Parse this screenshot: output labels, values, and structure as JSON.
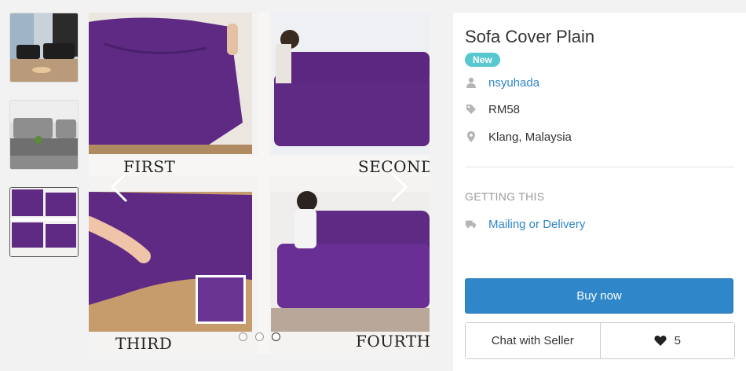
{
  "gallery": {
    "panel_labels": {
      "first": "FIRST",
      "second": "SECOND",
      "third": "THIRD",
      "fourth": "FOURTH"
    },
    "dots": 3,
    "active_dot": 3,
    "accent_purple": "#5e2a84"
  },
  "listing": {
    "title": "Sofa Cover Plain",
    "condition_badge": "New",
    "seller": "nsyuhada",
    "price": "RM58",
    "location": "Klang, Malaysia"
  },
  "getting": {
    "heading": "GETTING THIS",
    "method": "Mailing or Delivery"
  },
  "actions": {
    "buy_label": "Buy now",
    "chat_label": "Chat with Seller",
    "like_count": "5"
  },
  "colors": {
    "primary_blue": "#2f86c8",
    "badge_teal": "#57c8cf"
  },
  "icons": {
    "seller": "user-icon",
    "price": "price-tag-icon",
    "location": "map-pin-icon",
    "delivery": "truck-icon",
    "like": "heart-icon"
  }
}
